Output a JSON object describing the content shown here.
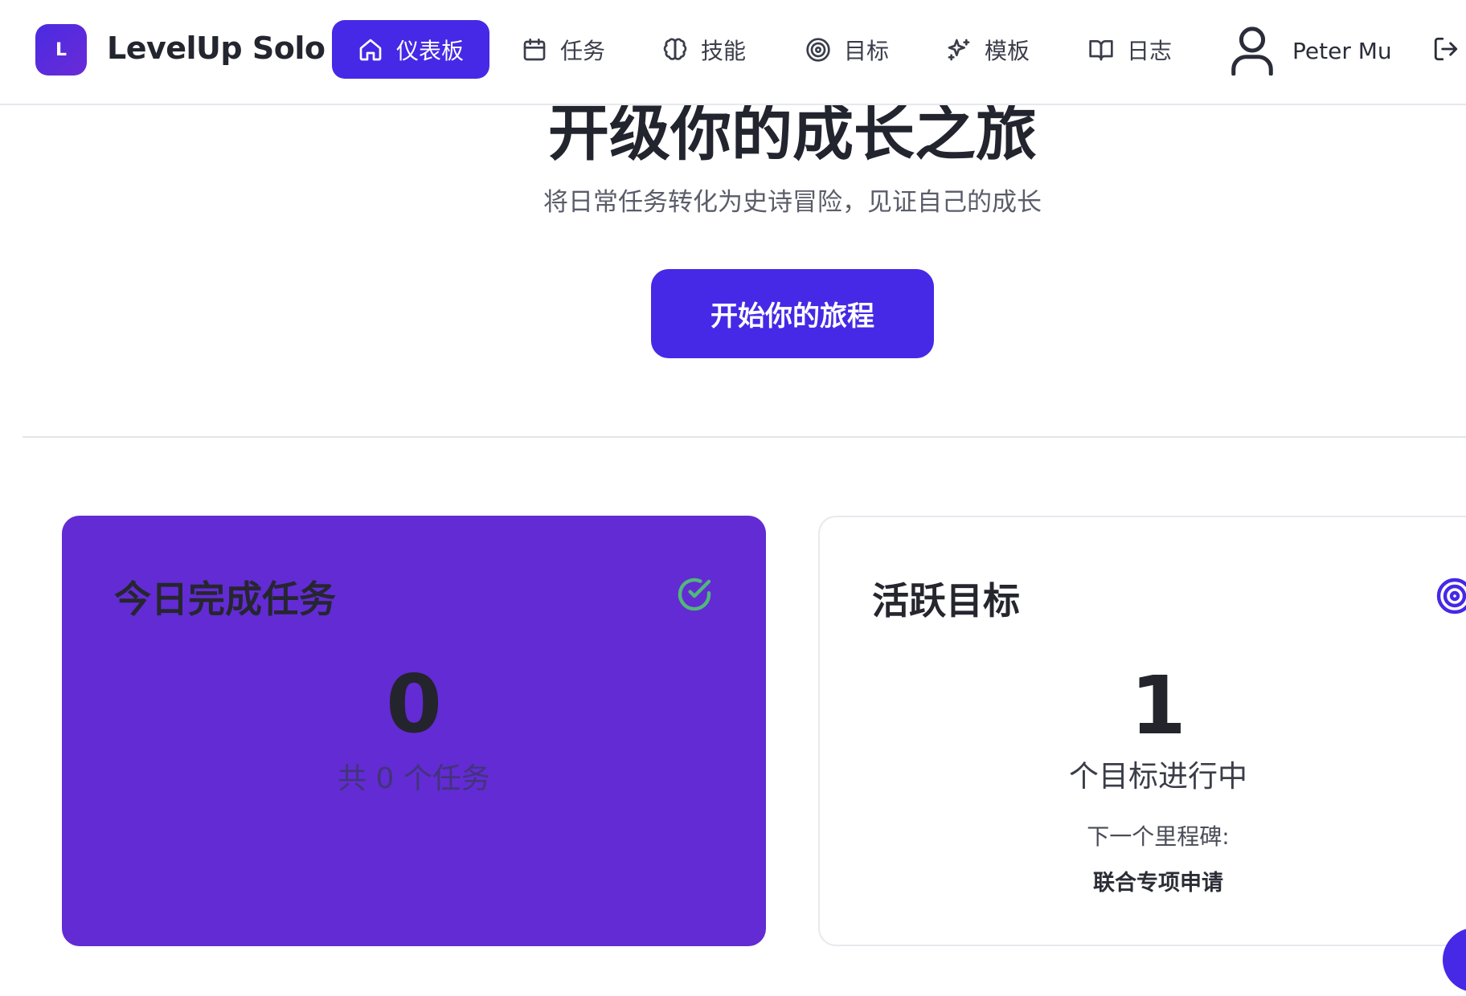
{
  "app": {
    "logo_letter": "L",
    "title": "LevelUp Solo"
  },
  "nav": {
    "items": [
      {
        "label": "仪表板",
        "icon": "home-icon",
        "active": true
      },
      {
        "label": "任务",
        "icon": "calendar-icon",
        "active": false
      },
      {
        "label": "技能",
        "icon": "brain-icon",
        "active": false
      },
      {
        "label": "目标",
        "icon": "target-icon",
        "active": false
      },
      {
        "label": "模板",
        "icon": "sparkles-icon",
        "active": false
      },
      {
        "label": "日志",
        "icon": "book-open-icon",
        "active": false
      }
    ]
  },
  "user": {
    "name": "Peter Mu",
    "avatar_icon": "user-icon",
    "logout_icon": "logout-icon"
  },
  "hero": {
    "title": "开级你的成长之旅",
    "subtitle": "将日常任务转化为史诗冒险，见证自己的成长",
    "cta_label": "开始你的旅程"
  },
  "cards": {
    "tasks": {
      "title": "今日完成任务",
      "count": "0",
      "subtitle": "共 0 个任务",
      "icon": "check-circle-icon"
    },
    "goals": {
      "title": "活跃目标",
      "count": "1",
      "subtitle": "个目标进行中",
      "milestone_label": "下一个里程碑:",
      "milestone_name": "联合专项申请",
      "icon": "target-icon"
    }
  },
  "colors": {
    "primary": "#4529e6",
    "tasks_card": "#632bd3",
    "check_green": "#4fb87a"
  }
}
